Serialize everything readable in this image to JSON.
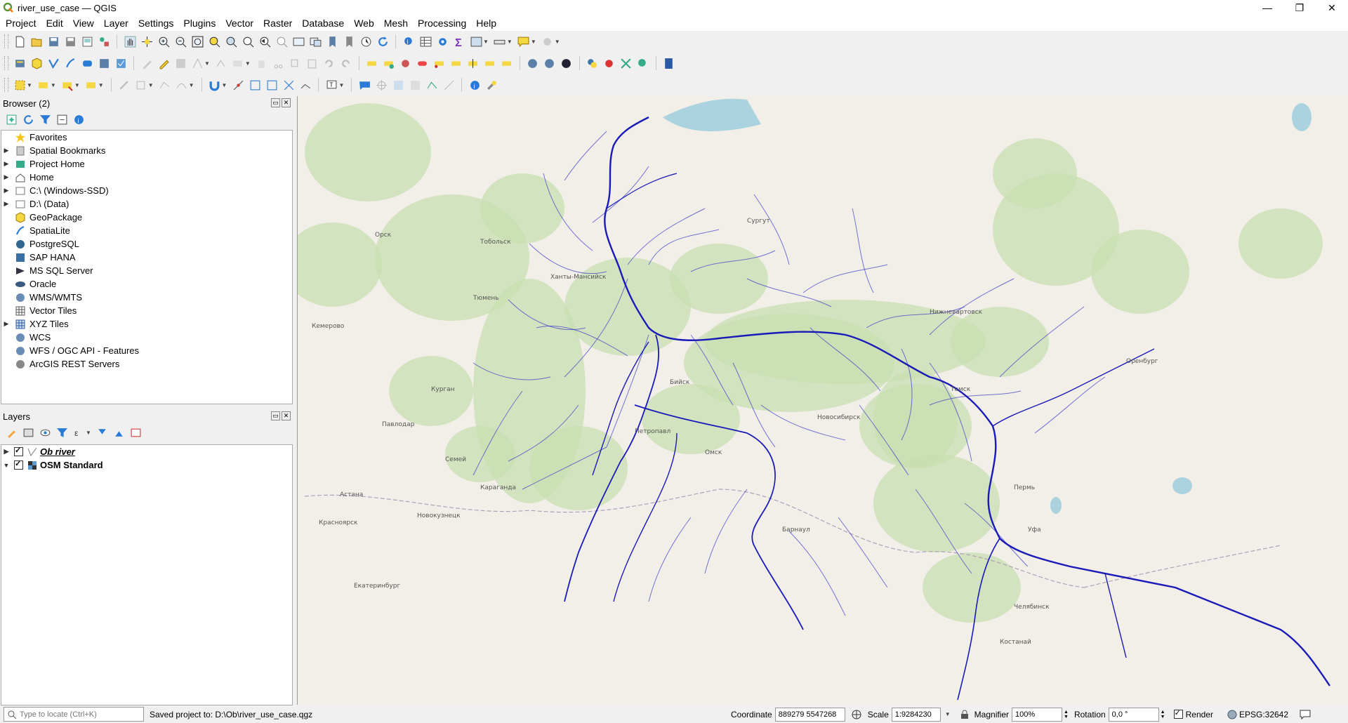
{
  "window": {
    "title": "river_use_case — QGIS",
    "minimize": "—",
    "maximize": "❐",
    "close": "✕"
  },
  "menu": [
    "Project",
    "Edit",
    "View",
    "Layer",
    "Settings",
    "Plugins",
    "Vector",
    "Raster",
    "Database",
    "Web",
    "Mesh",
    "Processing",
    "Help"
  ],
  "browser": {
    "title": "Browser (2)",
    "items": [
      {
        "label": "Favorites",
        "icon": "star-icon",
        "expand": false
      },
      {
        "label": "Spatial Bookmarks",
        "icon": "bookmark-icon",
        "expand": true
      },
      {
        "label": "Project Home",
        "icon": "project-home-icon",
        "expand": true
      },
      {
        "label": "Home",
        "icon": "home-folder-icon",
        "expand": true
      },
      {
        "label": "C:\\ (Windows-SSD)",
        "icon": "drive-icon",
        "expand": true
      },
      {
        "label": "D:\\ (Data)",
        "icon": "drive-icon",
        "expand": true
      },
      {
        "label": "GeoPackage",
        "icon": "geopackage-icon",
        "expand": false
      },
      {
        "label": "SpatiaLite",
        "icon": "spatialite-icon",
        "expand": false
      },
      {
        "label": "PostgreSQL",
        "icon": "postgresql-icon",
        "expand": false
      },
      {
        "label": "SAP HANA",
        "icon": "sap-hana-icon",
        "expand": false
      },
      {
        "label": "MS SQL Server",
        "icon": "mssql-icon",
        "expand": false
      },
      {
        "label": "Oracle",
        "icon": "oracle-icon",
        "expand": false
      },
      {
        "label": "WMS/WMTS",
        "icon": "wms-icon",
        "expand": false
      },
      {
        "label": "Vector Tiles",
        "icon": "vector-tiles-icon",
        "expand": false
      },
      {
        "label": "XYZ Tiles",
        "icon": "xyz-tiles-icon",
        "expand": true
      },
      {
        "label": "WCS",
        "icon": "wcs-icon",
        "expand": false
      },
      {
        "label": "WFS / OGC API - Features",
        "icon": "wfs-icon",
        "expand": false
      },
      {
        "label": "ArcGIS REST Servers",
        "icon": "arcgis-icon",
        "expand": false
      }
    ]
  },
  "layers": {
    "title": "Layers",
    "items": [
      {
        "label": "Ob river",
        "checked": true,
        "underline": true
      },
      {
        "label": "OSM Standard",
        "checked": true,
        "underline": false
      }
    ]
  },
  "status": {
    "locate_placeholder": "Type to locate (Ctrl+K)",
    "message": "Saved project to: D:\\Ob\\river_use_case.qgz",
    "coordinate_label": "Coordinate",
    "coordinate_value": "889279  5547268",
    "scale_label": "Scale",
    "scale_value": "1:9284230",
    "magnifier_label": "Magnifier",
    "magnifier_value": "100%",
    "rotation_label": "Rotation",
    "rotation_value": "0,0 °",
    "render_label": "Render",
    "crs": "EPSG:32642"
  },
  "map": {
    "river_color": "#1a1ab8",
    "tributary_color": "#3c3cc8",
    "forest_color": "#c8dfb0",
    "land_color": "#f2efe9",
    "water_color": "#aad3df",
    "place_labels": [
      "Петропавл",
      "Омск",
      "Новосибирск",
      "Барнаул",
      "Томск",
      "Сургут",
      "Ханты-Мансийск",
      "Тюмень",
      "Курган",
      "Астана",
      "Павлодар",
      "Караганда",
      "Кемерово",
      "Новокузнецк",
      "Красноярск",
      "Екатеринбург",
      "Челябинск",
      "Костанай",
      "Пермь",
      "Уфа",
      "Оренбург",
      "Орск",
      "Семей",
      "Бийск",
      "Нижневартовск",
      "Тобольск"
    ]
  }
}
